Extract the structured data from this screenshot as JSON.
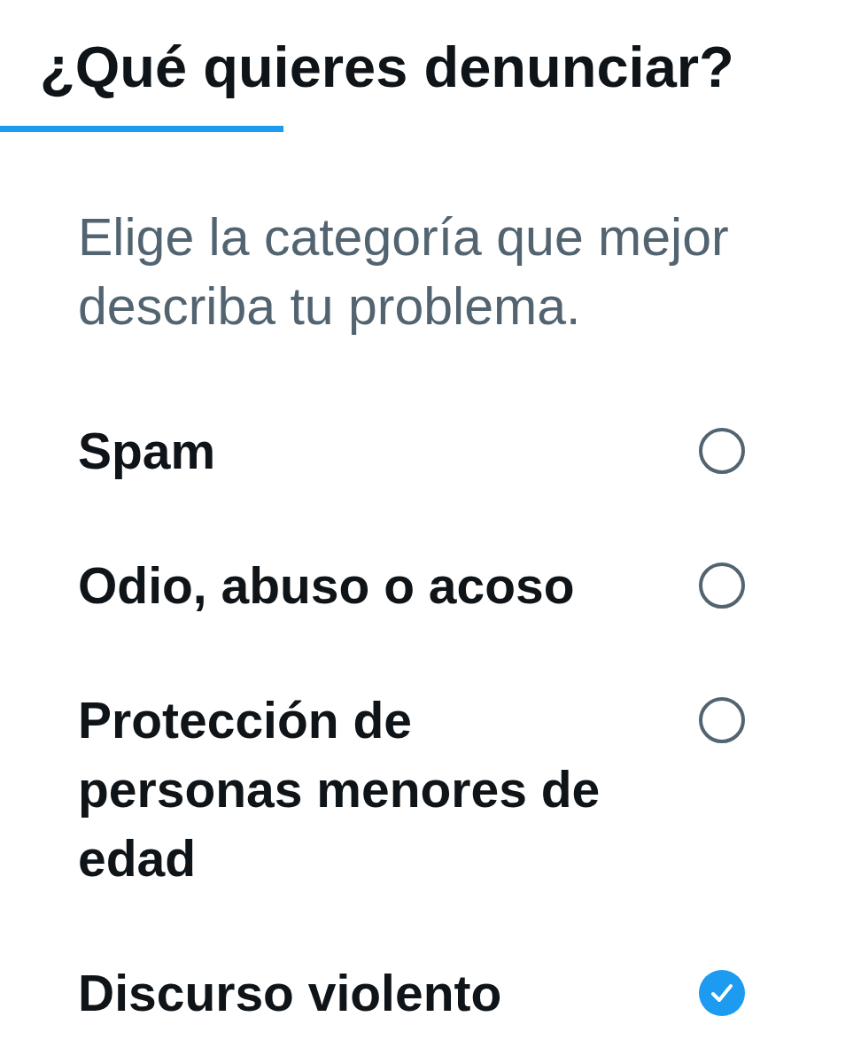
{
  "title": "¿Qué quieres denunciar?",
  "subtitle": "Elige la categoría que mejor describa tu problema.",
  "options": [
    {
      "label": "Spam",
      "selected": false
    },
    {
      "label": "Odio, abuso o acoso",
      "selected": false
    },
    {
      "label": "Protección de personas menores de edad",
      "selected": false
    },
    {
      "label": "Discurso violento",
      "selected": true
    }
  ]
}
